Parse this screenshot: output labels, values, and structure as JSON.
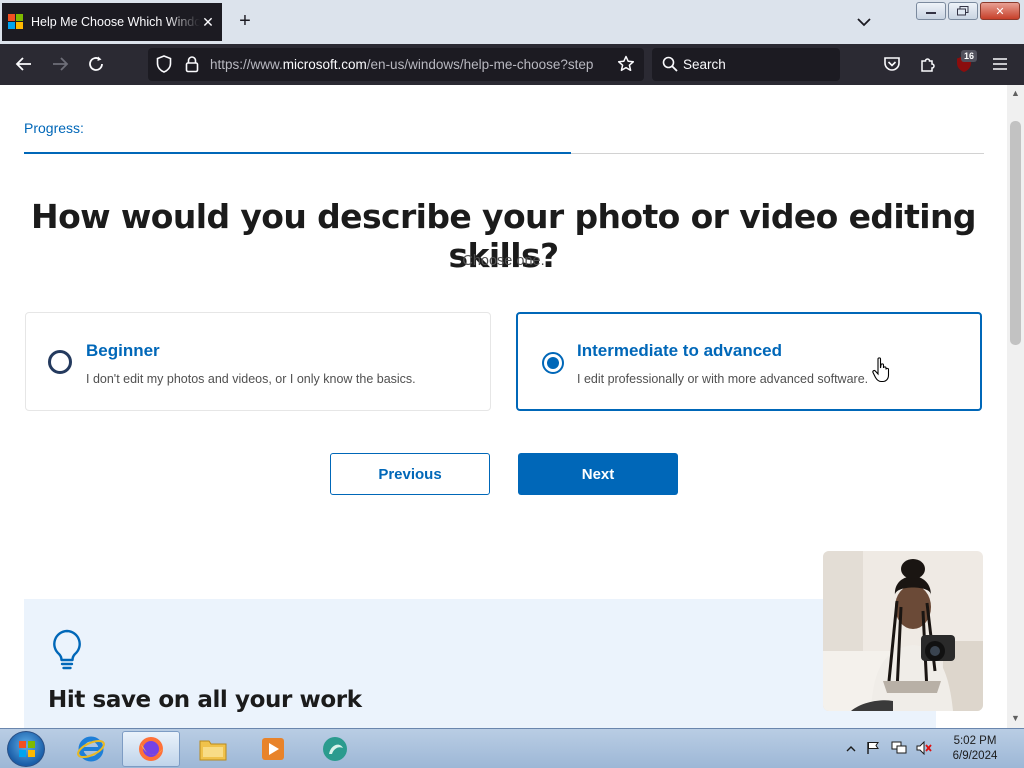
{
  "browser": {
    "tab_title": "Help Me Choose Which Windows",
    "url_prefix": "https://www.",
    "url_domain": "microsoft.com",
    "url_path": "/en-us/windows/help-me-choose?step",
    "search_placeholder": "Search",
    "extension_badge": "16",
    "window_controls": [
      "minimize",
      "restore",
      "close"
    ]
  },
  "page": {
    "progress_label": "Progress:",
    "progress": 0.57,
    "question": "How would you describe your photo or video editing skills?",
    "instruction": "Choose one.",
    "options": [
      {
        "title": "Beginner",
        "description": "I don't edit my photos and videos, or I only know the basics.",
        "selected": false
      },
      {
        "title": "Intermediate to advanced",
        "description": "I edit professionally or with more advanced software.",
        "selected": true
      }
    ],
    "previous_label": "Previous",
    "next_label": "Next",
    "tip_title": "Hit save on all your work"
  },
  "taskbar": {
    "time": "5:02 PM",
    "date": "6/9/2024",
    "apps": [
      "internet-explorer",
      "firefox",
      "file-explorer",
      "media-player",
      "app"
    ]
  },
  "colors": {
    "accent": "#0067b8",
    "browser_toolbar": "#2b2a33",
    "tip_background": "#ebf3fc"
  }
}
